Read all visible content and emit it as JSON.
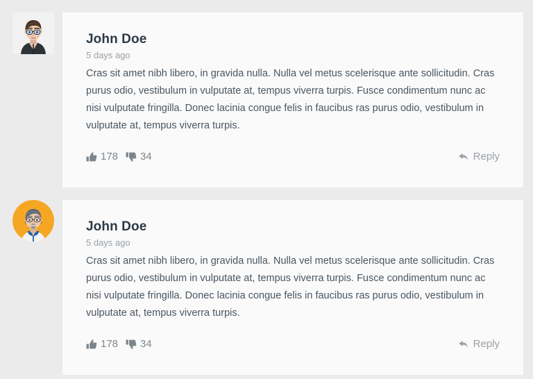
{
  "page": {
    "background_color": "#ebebeb",
    "card_background_color": "#fafafa"
  },
  "comments": [
    {
      "author": "John Doe",
      "timestamp": "5 days ago",
      "body": "Cras sit amet nibh libero, in gravida nulla. Nulla vel metus scelerisque ante sollicitudin. Cras purus odio, vestibulum in vulputate at, tempus viverra turpis. Fusce condimentum nunc ac nisi vulputate fringilla. Donec lacinia congue felis in faucibus ras purus odio, vestibulum in vulputate at, tempus viverra turpis.",
      "likes": "178",
      "dislikes": "34",
      "reply_label": "Reply",
      "like_icon": "thumbs-up-icon",
      "dislike_icon": "thumbs-down-icon",
      "reply_icon": "reply-arrow-icon",
      "avatar": {
        "name": "avatar-john-doe-1",
        "shape": "square",
        "background_color": "#f2f2f2",
        "description": "young man with brown hair and glasses wearing dark jacket"
      }
    },
    {
      "author": "John Doe",
      "timestamp": "5 days ago",
      "body": "Cras sit amet nibh libero, in gravida nulla. Nulla vel metus scelerisque ante sollicitudin. Cras purus odio, vestibulum in vulputate at, tempus viverra turpis. Fusce condimentum nunc ac nisi vulputate fringilla. Donec lacinia congue felis in faucibus ras purus odio, vestibulum in vulputate at, tempus viverra turpis.",
      "likes": "178",
      "dislikes": "34",
      "reply_label": "Reply",
      "like_icon": "thumbs-up-icon",
      "dislike_icon": "thumbs-down-icon",
      "reply_icon": "reply-arrow-icon",
      "avatar": {
        "name": "avatar-john-doe-2",
        "shape": "circle",
        "background_color": "#f5a623",
        "description": "older man with gray hair, glasses and goatee wearing white shirt with blue collar"
      }
    }
  ],
  "colors": {
    "author_text": "#2d3a46",
    "timestamp_text": "#98a0a6",
    "body_text": "#4a5560",
    "reaction_text": "#7d858c",
    "reply_text": "#9aa0a6"
  }
}
